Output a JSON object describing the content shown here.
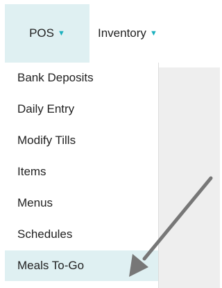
{
  "nav": {
    "tabs": [
      {
        "label": "POS",
        "caret": "▼"
      },
      {
        "label": "Inventory",
        "caret": "▼"
      }
    ]
  },
  "dropdown": {
    "items": [
      {
        "label": "Bank Deposits"
      },
      {
        "label": "Daily Entry"
      },
      {
        "label": "Modify Tills"
      },
      {
        "label": "Items"
      },
      {
        "label": "Menus"
      },
      {
        "label": "Schedules"
      },
      {
        "label": "Meals To-Go",
        "highlighted": true
      }
    ]
  },
  "colors": {
    "accent": "#1bb0be",
    "highlight_bg": "#dff0f2",
    "arrow": "#777777"
  }
}
